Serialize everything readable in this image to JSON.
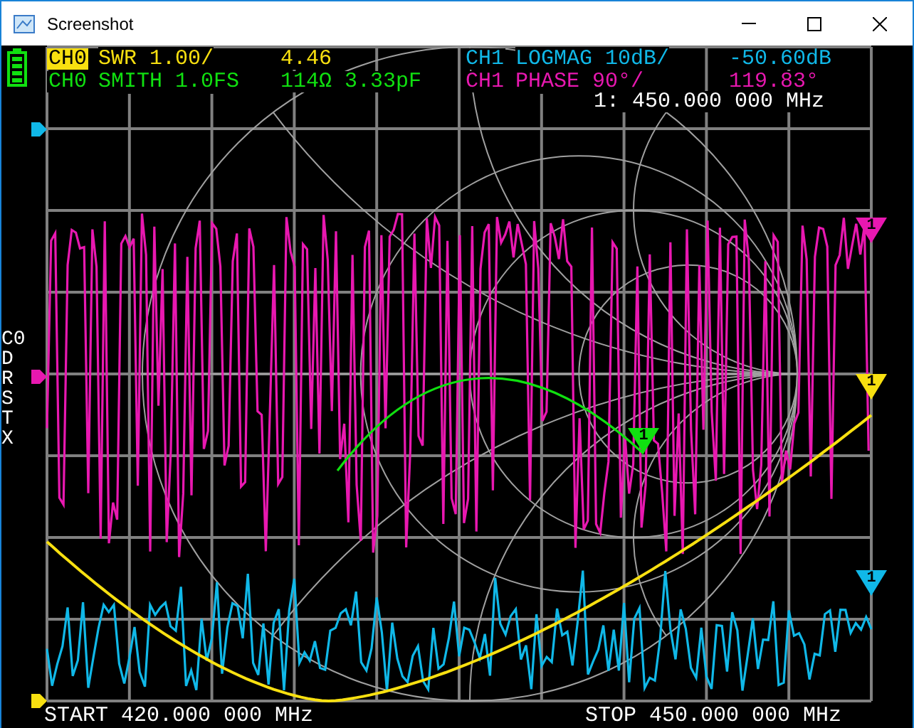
{
  "window": {
    "title": "Screenshot"
  },
  "traces": [
    {
      "channel": "CH0",
      "selected": true,
      "format": "SWR 1.00/",
      "value": "4.46",
      "color": "#f8e010",
      "marker": "1"
    },
    {
      "channel": "CH1",
      "selected": false,
      "format": "LOGMAG 10dB/",
      "value": "-50.60dB",
      "color": "#10b8e8",
      "marker": "1"
    },
    {
      "channel": "CH0",
      "selected": false,
      "format": "SMITH 1.0FS",
      "value": "114Ω 3.33pF",
      "color": "#10e010",
      "marker": "1"
    },
    {
      "channel": "CH1",
      "selected": false,
      "format": "PHASE 90°/",
      "value": "119.83°",
      "color": "#e818b0",
      "marker": "1"
    }
  ],
  "marker_readout": "1: 450.000 000 MHz",
  "side_menu": [
    "C0",
    "D",
    "R",
    "S",
    "T",
    "X"
  ],
  "footer": {
    "start": "START 420.000 000 MHz",
    "stop": "STOP 450.000 000 MHz"
  }
}
